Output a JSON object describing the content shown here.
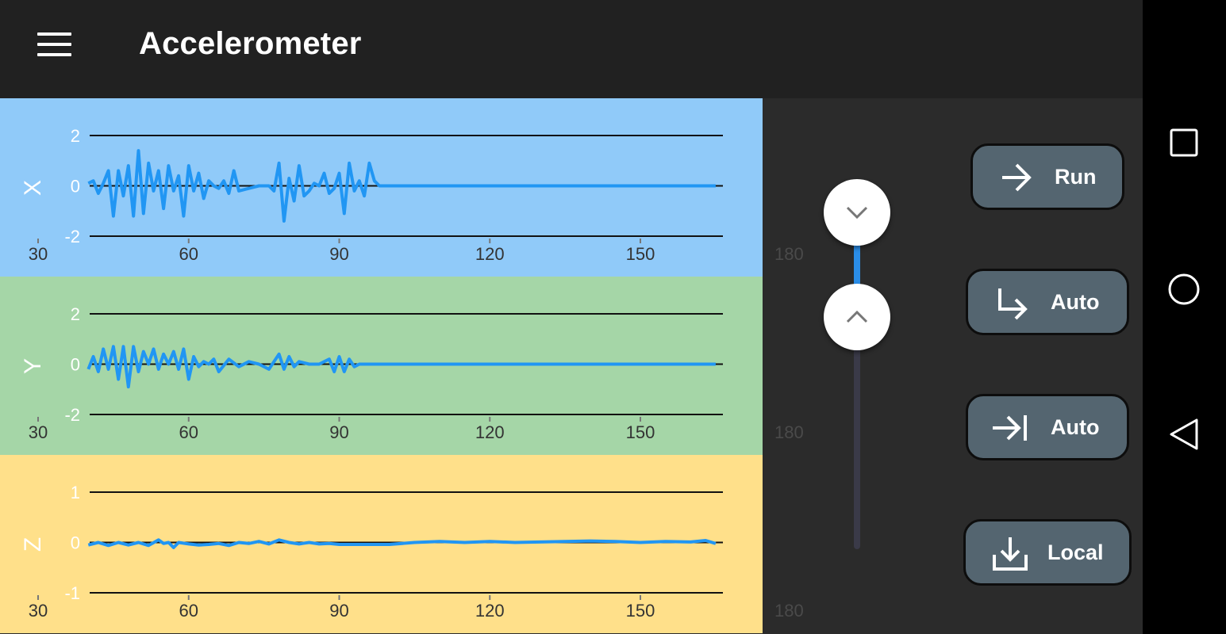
{
  "appbar": {
    "title": "Accelerometer",
    "menu_icon": "hamburger-menu-icon"
  },
  "charts": [
    {
      "axis": "X",
      "background": "#90caf9",
      "y_ticks": [
        "2",
        "0",
        "-2"
      ],
      "x_ticks": [
        "30",
        "60",
        "90",
        "120",
        "150"
      ],
      "ghost_tick": "180"
    },
    {
      "axis": "Y",
      "background": "#a5d6a7",
      "y_ticks": [
        "2",
        "0",
        "-2"
      ],
      "x_ticks": [
        "30",
        "60",
        "90",
        "120",
        "150"
      ],
      "ghost_tick": "180"
    },
    {
      "axis": "Z",
      "background": "#ffe08a",
      "y_ticks": [
        "1",
        "0",
        "-1"
      ],
      "x_ticks": [
        "30",
        "60",
        "90",
        "120",
        "150"
      ],
      "ghost_tick": "180"
    }
  ],
  "chart_data": [
    {
      "type": "line",
      "title": "",
      "ylabel": "X",
      "xlim": [
        40,
        165
      ],
      "ylim": [
        -2,
        2
      ],
      "series": [
        {
          "color": "#2196f3",
          "x": [
            40,
            41,
            42,
            43,
            44,
            45,
            46,
            47,
            48,
            49,
            50,
            51,
            52,
            53,
            54,
            55,
            56,
            57,
            58,
            59,
            60,
            61,
            62,
            63,
            64,
            65,
            66,
            67,
            68,
            69,
            70,
            72,
            74,
            76,
            77,
            78,
            79,
            80,
            81,
            82,
            83,
            84,
            85,
            86,
            87,
            88,
            89,
            90,
            91,
            92,
            93,
            94,
            95,
            96,
            97,
            98,
            100,
            110,
            120,
            130,
            140,
            150,
            160,
            165
          ],
          "y": [
            0.1,
            0.2,
            -0.3,
            0.1,
            0.6,
            -1.2,
            0.6,
            -0.4,
            0.8,
            -1.2,
            1.4,
            -1.1,
            0.9,
            -0.2,
            0.6,
            -0.9,
            0.8,
            -0.2,
            0.4,
            -1.2,
            0.8,
            -0.2,
            0.5,
            -0.5,
            0.2,
            0.0,
            -0.1,
            0.2,
            -0.3,
            0.6,
            -0.2,
            -0.1,
            0.0,
            0.0,
            -0.2,
            0.9,
            -1.4,
            0.3,
            -0.6,
            0.8,
            -0.4,
            -0.2,
            0.1,
            0.0,
            0.5,
            -0.3,
            -0.1,
            0.5,
            -1.1,
            0.9,
            -0.2,
            0.2,
            -0.4,
            0.9,
            0.2,
            0.0,
            0.0,
            0.0,
            0.0,
            0.0,
            0.0,
            0.0,
            0.0,
            0.0
          ]
        }
      ]
    },
    {
      "type": "line",
      "title": "",
      "ylabel": "Y",
      "xlim": [
        40,
        165
      ],
      "ylim": [
        -2,
        2
      ],
      "series": [
        {
          "color": "#2196f3",
          "x": [
            40,
            41,
            42,
            43,
            44,
            45,
            46,
            47,
            48,
            49,
            50,
            51,
            52,
            53,
            54,
            55,
            56,
            57,
            58,
            59,
            60,
            61,
            62,
            63,
            64,
            65,
            66,
            68,
            70,
            72,
            74,
            76,
            77,
            78,
            79,
            80,
            81,
            82,
            84,
            86,
            88,
            89,
            90,
            91,
            92,
            93,
            94,
            95,
            96,
            97,
            98,
            100,
            110,
            120,
            130,
            140,
            150,
            160,
            165
          ],
          "y": [
            -0.2,
            0.3,
            -0.3,
            0.6,
            -0.2,
            0.7,
            -0.6,
            0.7,
            -0.9,
            0.7,
            -0.3,
            0.5,
            0.0,
            0.6,
            -0.2,
            0.4,
            0.0,
            0.5,
            -0.2,
            0.6,
            -0.6,
            0.3,
            -0.1,
            0.1,
            0.0,
            0.2,
            -0.3,
            0.2,
            -0.1,
            0.1,
            0.0,
            -0.2,
            0.1,
            0.4,
            -0.2,
            0.3,
            -0.1,
            0.1,
            0.0,
            0.0,
            0.2,
            -0.3,
            0.3,
            -0.3,
            0.2,
            -0.1,
            0.0,
            0.0,
            0.0,
            0.0,
            0.0,
            0.0,
            0.0,
            0.0,
            0.0,
            0.0,
            0.0,
            0.0,
            0.0
          ]
        }
      ]
    },
    {
      "type": "line",
      "title": "",
      "ylabel": "Z",
      "xlim": [
        40,
        165
      ],
      "ylim": [
        -1,
        1
      ],
      "series": [
        {
          "color": "#2196f3",
          "x": [
            40,
            42,
            44,
            46,
            48,
            50,
            52,
            54,
            55,
            56,
            57,
            58,
            60,
            62,
            64,
            66,
            68,
            70,
            72,
            74,
            76,
            78,
            80,
            82,
            84,
            86,
            88,
            90,
            95,
            100,
            105,
            110,
            115,
            120,
            125,
            130,
            135,
            140,
            145,
            150,
            155,
            160,
            163,
            165
          ],
          "y": [
            -0.05,
            0.0,
            -0.06,
            0.0,
            -0.05,
            0.0,
            -0.06,
            0.05,
            -0.02,
            0.0,
            -0.1,
            0.0,
            -0.03,
            -0.05,
            -0.04,
            -0.02,
            -0.06,
            0.0,
            -0.02,
            0.02,
            -0.03,
            0.05,
            0.0,
            -0.03,
            0.0,
            -0.03,
            -0.02,
            -0.04,
            -0.04,
            -0.04,
            0.0,
            0.02,
            0.0,
            0.02,
            0.0,
            0.01,
            0.02,
            0.03,
            0.02,
            0.0,
            0.02,
            0.01,
            0.04,
            -0.02
          ]
        }
      ]
    }
  ],
  "slider": {
    "down_icon": "chevron-down-icon",
    "up_icon": "chevron-up-icon"
  },
  "controls": {
    "run_label": "Run",
    "auto_start_label": "Auto",
    "auto_stop_label": "Auto",
    "local_label": "Local"
  },
  "navbar": {
    "recents_icon": "square-recents-icon",
    "home_icon": "circle-home-icon",
    "back_icon": "triangle-back-icon"
  }
}
